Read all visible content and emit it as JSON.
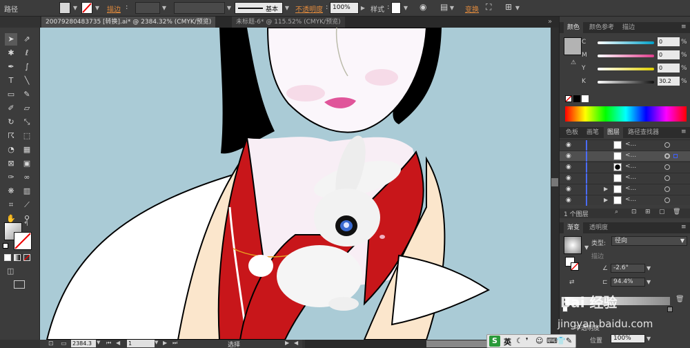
{
  "control_bar": {
    "mode_label": "路径",
    "stroke_label": "描边",
    "brush_value": "基本",
    "opacity_label": "不透明度",
    "opacity_value": "100%",
    "style_label": "样式",
    "transform_label": "变换"
  },
  "tabs": [
    {
      "label": "20079280483735 [转换].ai* @ 2384.32% (CMYK/预览)",
      "active": true
    },
    {
      "label": "未标题-6* @ 115.52% (CMYK/预览)",
      "active": false
    }
  ],
  "panels": {
    "color": {
      "tabs": [
        "颜色",
        "颜色参考",
        "描边"
      ],
      "sliders": [
        {
          "label": "C",
          "value": "0",
          "color": "#00a0c8"
        },
        {
          "label": "M",
          "value": "0",
          "color": "#e03c8c"
        },
        {
          "label": "Y",
          "value": "0",
          "color": "#e0d000"
        },
        {
          "label": "K",
          "value": "30.2",
          "color": "#909090"
        }
      ],
      "percent_sign": "%"
    },
    "layers": {
      "tabs": [
        "色板",
        "画笔",
        "图层",
        "路径查找器"
      ],
      "rows": [
        {
          "name": "<...",
          "selected": false
        },
        {
          "name": "<...",
          "selected": true
        },
        {
          "name": "<...",
          "selected": false
        },
        {
          "name": "<...",
          "selected": false
        },
        {
          "name": "<...",
          "selected": false
        },
        {
          "name": "<...",
          "selected": false
        }
      ],
      "footer": "1 个图层"
    },
    "gradient": {
      "tabs": [
        "渐变",
        "透明度"
      ],
      "type_label": "类型:",
      "type_value": "径向",
      "stroke_label": "描边",
      "angle_value": "-2.6°",
      "ratio_value": "94.4%",
      "opacity_label": "不透明度",
      "position_label": "位置",
      "position_value": "100%"
    }
  },
  "status": {
    "zoom": "2384.3",
    "artboard": "1",
    "mode": "选择"
  },
  "ime": {
    "lang": "英"
  },
  "watermark": {
    "text": "Bai 经验",
    "url": "jingyan.baidu.com"
  },
  "colors": {
    "canvas_bg": "#aacbd6",
    "accent_orange": "#e08a3c",
    "robe_red": "#c8161a",
    "skin": "#fbe6cc"
  }
}
